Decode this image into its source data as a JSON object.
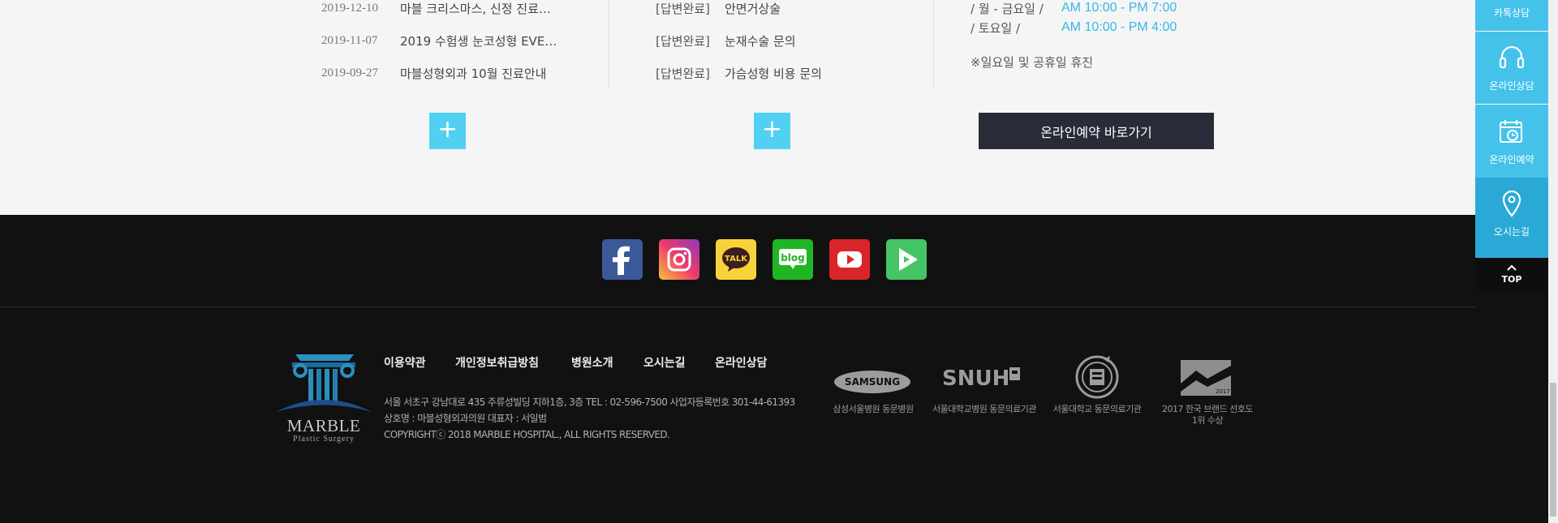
{
  "notices": [
    {
      "date": "2019-12-10",
      "title": "마블 크리스마스, 신정 진료…"
    },
    {
      "date": "2019-11-07",
      "title": "2019 수험생 눈코성형 EVE…"
    },
    {
      "date": "2019-09-27",
      "title": "마블성형외과 10월 진료안내"
    }
  ],
  "qna": [
    {
      "tag": "[답변완료]",
      "title": "안면거상술"
    },
    {
      "tag": "[답변완료]",
      "title": "눈재수술 문의"
    },
    {
      "tag": "[답변완료]",
      "title": "가슴성형 비용 문의"
    }
  ],
  "hours": {
    "rows": [
      {
        "label": "/  월 - 금요일  /",
        "value": "AM 10:00 - PM 7:00"
      },
      {
        "label": "/  토요일  /",
        "value": "AM 10:00 - PM 4:00"
      }
    ],
    "note": "※일요일 및 공휴일 휴진"
  },
  "more_label": "+",
  "reservation_button": "온라인예약 바로가기",
  "sns_icons": [
    "facebook-icon",
    "instagram-icon",
    "kakaotalk-icon",
    "blog-icon",
    "youtube-icon",
    "play-icon"
  ],
  "sns_text": {
    "talk": "TALK",
    "blog": "blog"
  },
  "footer": {
    "nav": [
      "이용약관",
      "개인정보취급방침",
      "병원소개",
      "오시는길",
      "온라인상담"
    ],
    "address": "서울 서초구 강남대로 435 주류성빌딩 지하1층, 3층    TEL : 02-596-7500    사업자등록번호 301-44-61393",
    "company": "상호명 : 마블성형외과의원    대표자 : 서일범",
    "copyright": "COPYRIGHTⓒ 2018 MARBLE HOSPITAL., ALL RIGHTS RESERVED.",
    "logo": {
      "name": "MARBLE",
      "sub": "Plastic Surgery"
    },
    "partners": [
      {
        "mark": "SAMSUNG",
        "caption": "삼성서울병원 동문병원"
      },
      {
        "mark": "SNUH",
        "caption": "서울대학교병원 동문의료기관"
      },
      {
        "mark": "",
        "caption": "서울대학교 동문의료기관"
      },
      {
        "mark": "2017 KBPA",
        "caption": "2017 한국 브랜드 선호도\n1위 수상"
      }
    ]
  },
  "quickbar": {
    "items": [
      "카톡상담",
      "온라인상담",
      "온라인예약",
      "오시는길"
    ],
    "top": "TOP"
  },
  "colors": {
    "accent": "#45c2ea",
    "plus": "#52d0f1",
    "hours": "#35b7e8",
    "button_dark": "#282c38",
    "footer_bg": "#111111"
  }
}
